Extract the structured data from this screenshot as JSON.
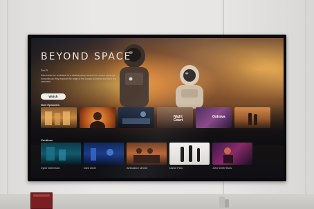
{
  "hero": {
    "title": "BEYOND SPACE",
    "meta": "Sci-Fi",
    "description": "Astronauts on a mission to a distant planet search for a new home for humanity as they explore the edge of the known universe and face the unknown.",
    "watch_label": "Watch"
  },
  "rows": [
    {
      "label": "New Episodes",
      "tiles": [
        {
          "art": "warm-hall",
          "overlay": ""
        },
        {
          "art": "portrait-orange",
          "overlay": ""
        },
        {
          "art": "blue-scene",
          "overlay": ""
        },
        {
          "art": "drama-title",
          "overlay": "Night Court"
        },
        {
          "art": "purple-title",
          "overlay": "Ostrava"
        },
        {
          "art": "couple-sunset",
          "overlay": ""
        }
      ]
    },
    {
      "label": "Continue",
      "tiles": [
        {
          "art": "cyber-blue",
          "caption": "Cyber Dimension"
        },
        {
          "art": "neon-room",
          "caption": "Dark Circle"
        },
        {
          "art": "warm-band",
          "caption": "Ambulance service"
        },
        {
          "art": "white-dancers",
          "caption": "Dance Flow"
        },
        {
          "art": "purple-stage",
          "caption": "John Smith Show"
        }
      ]
    }
  ],
  "colors": {
    "hero_glow": "#ffc45c",
    "screen_bg": "#0f1014",
    "button_bg": "#f1efec",
    "book": "#7a1e22"
  }
}
